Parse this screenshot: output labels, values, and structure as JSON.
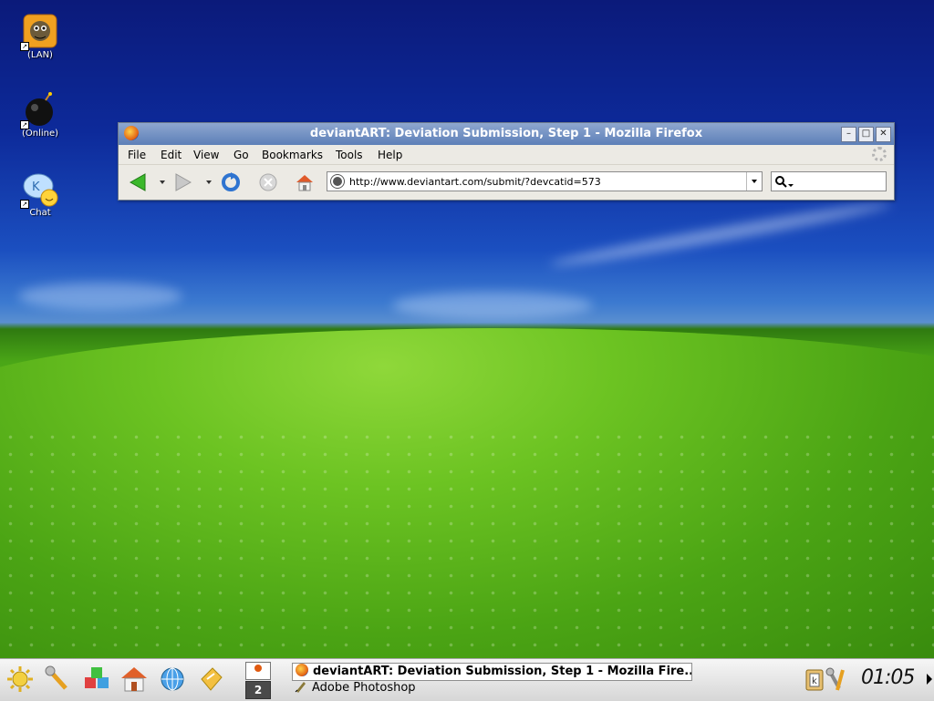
{
  "desktop": {
    "icons": [
      {
        "label": "(LAN)",
        "icon": "gimp-icon"
      },
      {
        "label": "(Online)",
        "icon": "bomb-icon"
      },
      {
        "label": "Chat",
        "icon": "chat-icon"
      }
    ]
  },
  "browser": {
    "title": "deviantART: Deviation Submission, Step 1 - Mozilla Firefox",
    "menu": [
      "File",
      "Edit",
      "View",
      "Go",
      "Bookmarks",
      "Tools",
      "Help"
    ],
    "url": "http://www.deviantart.com/submit/?devcatid=573",
    "search_placeholder": ""
  },
  "taskbar": {
    "desktop_number": "2",
    "tasks": [
      {
        "label": "deviantART: Deviation Submission, Step 1 - Mozilla Fire...",
        "icon": "firefox-icon",
        "active": true
      },
      {
        "label": "Adobe Photoshop",
        "icon": "photoshop-icon",
        "active": false
      }
    ],
    "clock": "01:05"
  }
}
